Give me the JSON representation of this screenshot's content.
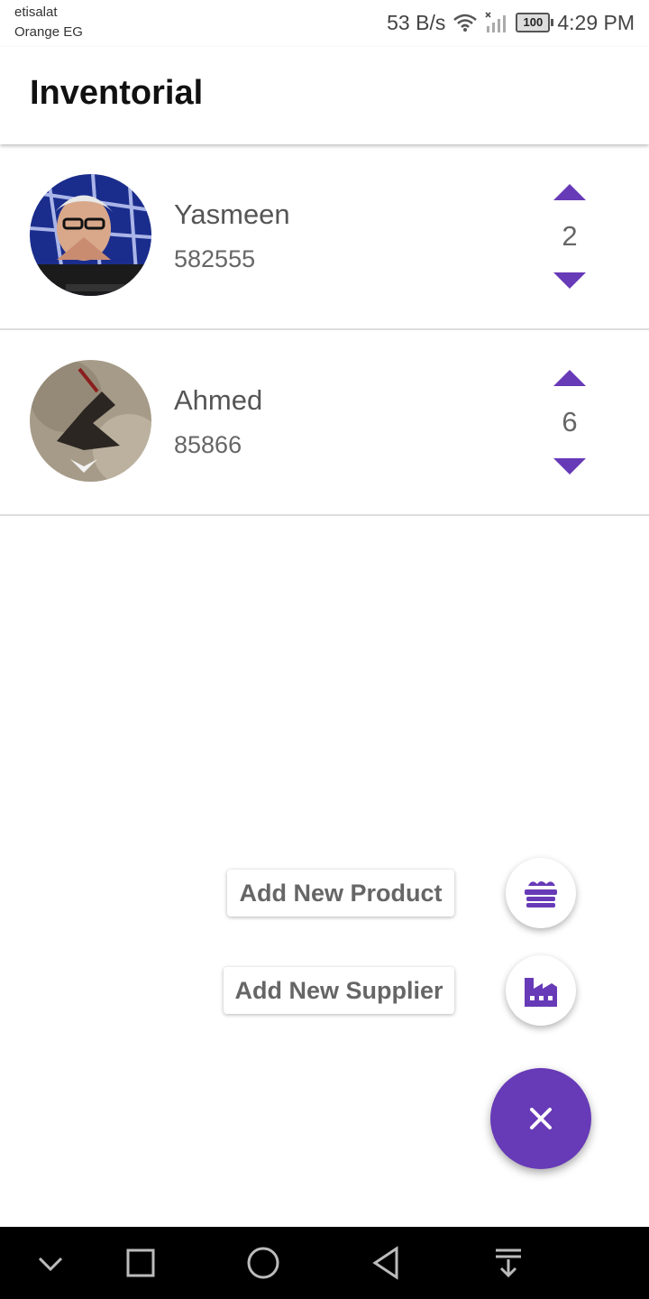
{
  "status_bar": {
    "carrier_primary": "etisalat",
    "carrier_secondary": "Orange EG",
    "net_speed": "53 B/s",
    "battery": "100",
    "time": "4:29 PM"
  },
  "app": {
    "title": "Inventorial"
  },
  "items": [
    {
      "name": "Yasmeen",
      "code": "582555",
      "quantity": "2"
    },
    {
      "name": "Ahmed",
      "code": "85866",
      "quantity": "6"
    }
  ],
  "fab_menu": {
    "add_product_label": "Add New Product",
    "add_supplier_label": "Add New Supplier",
    "main_icon": "close-icon"
  },
  "colors": {
    "accent": "#673ab7",
    "text_secondary": "#666666"
  }
}
